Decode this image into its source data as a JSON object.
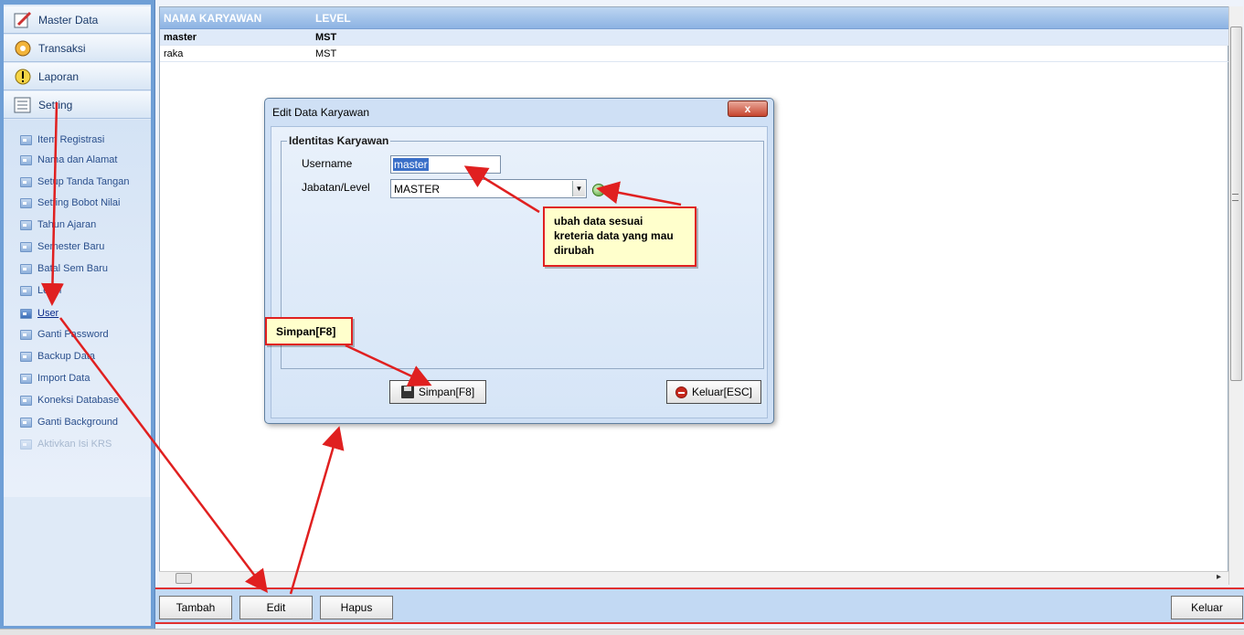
{
  "sidebar": {
    "groups": [
      "Master Data",
      "Transaksi",
      "Laporan",
      "Setting"
    ],
    "items": [
      "Item Registrasi",
      "Nama dan Alamat",
      "Setup Tanda Tangan",
      "Setting Bobot Nilai",
      "Tahun Ajaran",
      "Semester Baru",
      "Batal Sem Baru",
      "Level",
      "User",
      "Ganti Password",
      "Backup Data",
      "Import Data",
      "Koneksi Database",
      "Ganti Background",
      "Aktivkan Isi KRS"
    ],
    "active_item": "User",
    "disabled_item": "Aktivkan Isi KRS"
  },
  "grid": {
    "columns": [
      "NAMA KARYAWAN",
      "LEVEL"
    ],
    "rows": [
      [
        "master",
        "MST"
      ],
      [
        "raka",
        "MST"
      ]
    ]
  },
  "toolbar": {
    "tambah": "Tambah",
    "edit": "Edit",
    "hapus": "Hapus",
    "keluar": "Keluar"
  },
  "dialog": {
    "title": "Edit Data Karyawan",
    "close": "x",
    "group_title": "Identitas Karyawan",
    "username_label": "Username",
    "username_value": "master",
    "level_label": "Jabatan/Level",
    "level_value": "MASTER",
    "save_label": "Simpan[F8]",
    "exit_label": "Keluar[ESC]"
  },
  "callouts": {
    "hint": "ubah data sesuai kreteria data yang mau dirubah",
    "save": "Simpan[F8]"
  },
  "colors": {
    "accent": "#8db3e3",
    "annotation": "#e02020"
  }
}
